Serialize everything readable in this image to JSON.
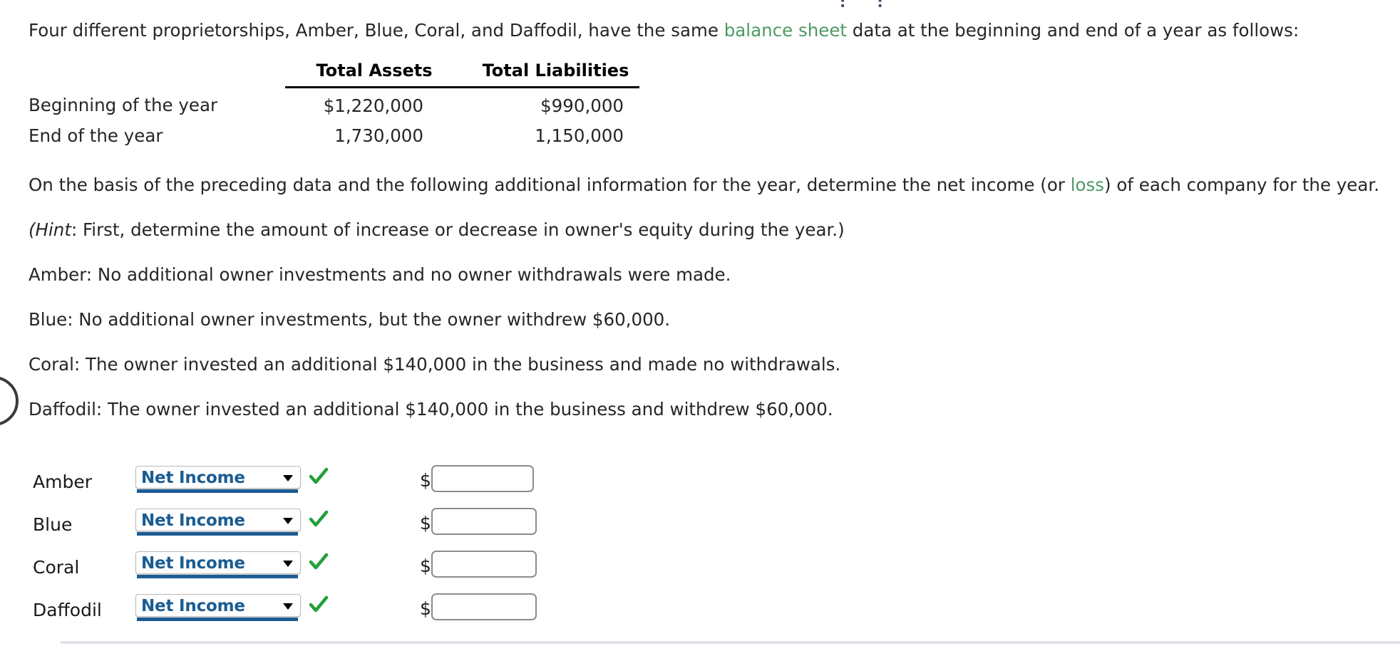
{
  "intro": {
    "before_link": "Four different proprietorships, Amber, Blue, Coral, and Daffodil, have the same ",
    "link": "balance sheet",
    "after_link": " data at the beginning and end of a year as follows:"
  },
  "balance_table": {
    "headers": [
      "",
      "Total Assets",
      "Total Liabilities"
    ],
    "rows": [
      {
        "label": "Beginning of the year",
        "total_assets": "$1,220,000",
        "total_liabilities": "$990,000"
      },
      {
        "label": "End of the year",
        "total_assets": "1,730,000",
        "total_liabilities": "1,150,000"
      }
    ]
  },
  "instructions": {
    "basis_before_link": "On the basis of the preceding data and the following additional information for the year, determine the net income (or ",
    "basis_link": "loss",
    "basis_after_link": ") of each company for the year.",
    "hint_emphasis": "(Hint",
    "hint_rest": ": First, determine the amount of increase or decrease in owner's equity during the year.)",
    "amber": "Amber: No additional owner investments and no owner withdrawals were made.",
    "blue": "Blue: No additional owner investments, but the owner withdrew $60,000.",
    "coral": "Coral: The owner invested an additional $140,000 in the business and made no withdrawals.",
    "daffodil": "Daffodil: The owner invested an additional $140,000 in the business and withdrew $60,000."
  },
  "answers": {
    "currency_symbol": "$",
    "rows": [
      {
        "company": "Amber",
        "selected_option": "Net Income",
        "amount_value": "",
        "amount_placeholder": ""
      },
      {
        "company": "Blue",
        "selected_option": "Net Income",
        "amount_value": "",
        "amount_placeholder": ""
      },
      {
        "company": "Coral",
        "selected_option": "Net Income",
        "amount_value": "",
        "amount_placeholder": ""
      },
      {
        "company": "Daffodil",
        "selected_option": "Net Income",
        "amount_value": "",
        "amount_placeholder": ""
      }
    ]
  },
  "colors": {
    "link_green": "#4e9a63",
    "select_blue": "#1a5c93",
    "check_green": "#22a039",
    "rule_gray": "#dfe3e8"
  },
  "top_clip": "::"
}
